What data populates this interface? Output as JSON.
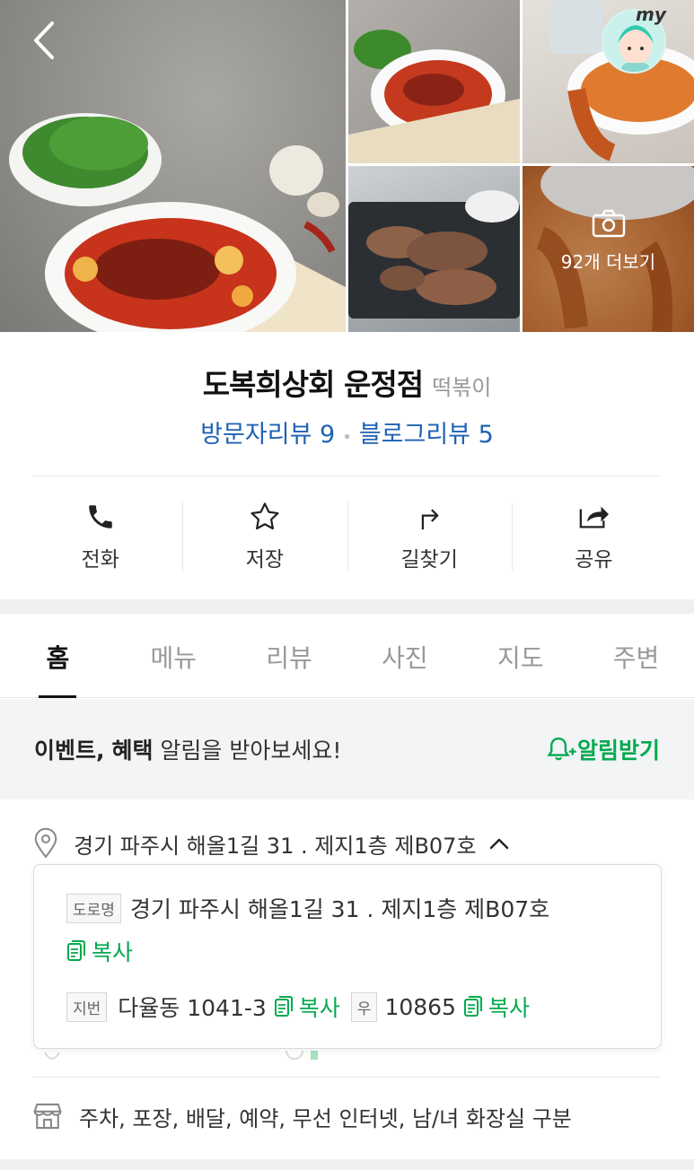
{
  "gallery": {
    "more_photos": "92개 더보기",
    "profile_tag": "my"
  },
  "place": {
    "name": "도복희상회 운정점",
    "category": "떡볶이",
    "visitor_reviews": "방문자리뷰 9",
    "blog_reviews": "블로그리뷰 5"
  },
  "actions": [
    {
      "label": "전화",
      "icon": "phone-icon"
    },
    {
      "label": "저장",
      "icon": "star-icon"
    },
    {
      "label": "길찾기",
      "icon": "directions-icon"
    },
    {
      "label": "공유",
      "icon": "share-icon"
    }
  ],
  "tabs": [
    "홈",
    "메뉴",
    "리뷰",
    "사진",
    "지도",
    "주변"
  ],
  "notice": {
    "bold1": "이벤트,",
    "bold2": "혜택",
    "text": "알림을 받아보세요!",
    "button": "알림받기"
  },
  "address": {
    "summary": "경기 파주시 해올1길 31 . 제지1층 제B07호",
    "road_tag": "도로명",
    "road": "경기 파주시 해올1길 31 . 제지1층 제B07호",
    "copy": "복사",
    "lot_tag": "지번",
    "lot": "다율동 1041-3",
    "zip_tag": "우",
    "zip": "10865"
  },
  "facilities": "주차, 포장, 배달, 예약, 무선 인터넷, 남/녀 화장실 구분",
  "colors": {
    "accent_green": "#03aa4f",
    "link_blue": "#1e62b4"
  }
}
